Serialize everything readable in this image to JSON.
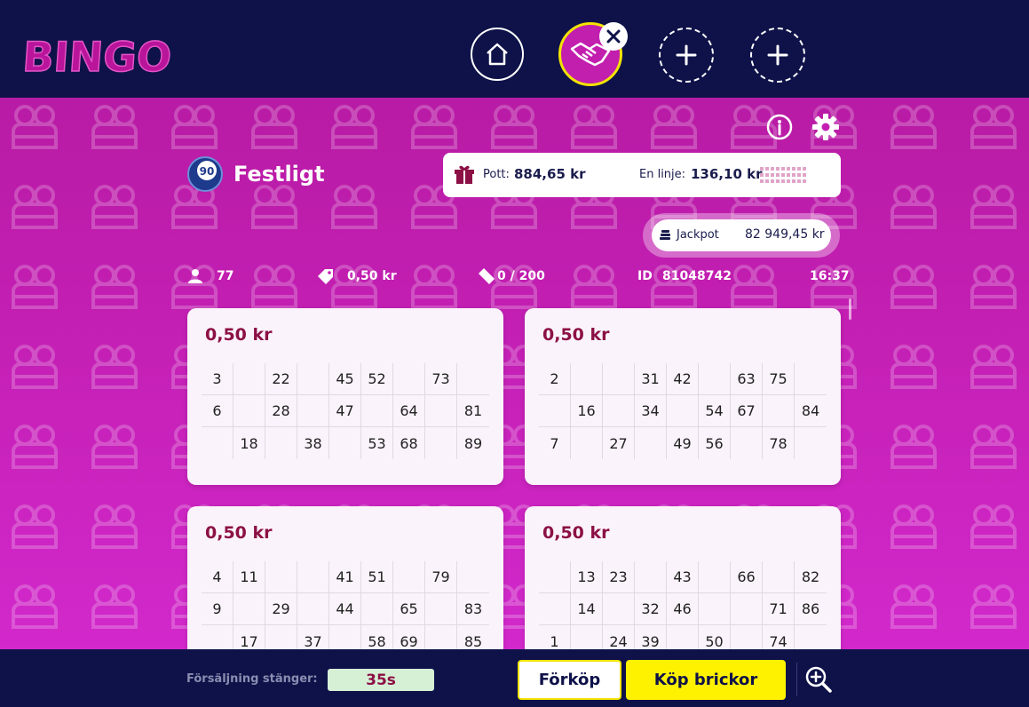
{
  "app": {
    "logo_text": "BINGO"
  },
  "nav": {
    "home_icon": "home-icon",
    "active_room_icon": "handshake-icon",
    "close_icon": "close-icon",
    "add_icon": "plus-icon"
  },
  "game": {
    "ball_number": "90",
    "title": "Festligt",
    "pott_label": "Pott:",
    "pott_value": "884,65 kr",
    "line_label": "En linje:",
    "line_value": "136,10 kr",
    "jackpot_label": "Jackpot",
    "jackpot_value": "82 949,45 kr"
  },
  "stats": {
    "players": "77",
    "price": "0,50 kr",
    "tickets": "0 / 200",
    "id_label": "ID",
    "id_value": "81048742",
    "time": "16:37"
  },
  "cards": [
    {
      "price": "0,50 kr",
      "rows": [
        [
          "3",
          "",
          "22",
          "",
          "45",
          "52",
          "",
          "73",
          ""
        ],
        [
          "6",
          "",
          "28",
          "",
          "47",
          "",
          "64",
          "",
          "81"
        ],
        [
          "",
          "18",
          "",
          "38",
          "",
          "53",
          "68",
          "",
          "89"
        ]
      ]
    },
    {
      "price": "0,50 kr",
      "rows": [
        [
          "2",
          "",
          "",
          "31",
          "42",
          "",
          "63",
          "75",
          ""
        ],
        [
          "",
          "16",
          "",
          "34",
          "",
          "54",
          "67",
          "",
          "84"
        ],
        [
          "7",
          "",
          "27",
          "",
          "49",
          "56",
          "",
          "78",
          ""
        ]
      ]
    },
    {
      "price": "0,50 kr",
      "rows": [
        [
          "4",
          "11",
          "",
          "",
          "41",
          "51",
          "",
          "79",
          ""
        ],
        [
          "9",
          "",
          "29",
          "",
          "44",
          "",
          "65",
          "",
          "83"
        ],
        [
          "",
          "17",
          "",
          "37",
          "",
          "58",
          "69",
          "",
          "85"
        ]
      ]
    },
    {
      "price": "0,50 kr",
      "rows": [
        [
          "",
          "13",
          "23",
          "",
          "43",
          "",
          "66",
          "",
          "82"
        ],
        [
          "",
          "14",
          "",
          "32",
          "46",
          "",
          "",
          "71",
          "86"
        ],
        [
          "1",
          "",
          "24",
          "39",
          "",
          "50",
          "",
          "74",
          ""
        ]
      ]
    }
  ],
  "footer": {
    "closing_label": "Försäljning stänger:",
    "timer": "35s",
    "prebuy_label": "Förköp",
    "buy_label": "Köp brickor"
  },
  "colors": {
    "navy": "#0e1249",
    "magenta": "#c31fb3",
    "yellow": "#fff200",
    "price_red": "#8c1045"
  }
}
